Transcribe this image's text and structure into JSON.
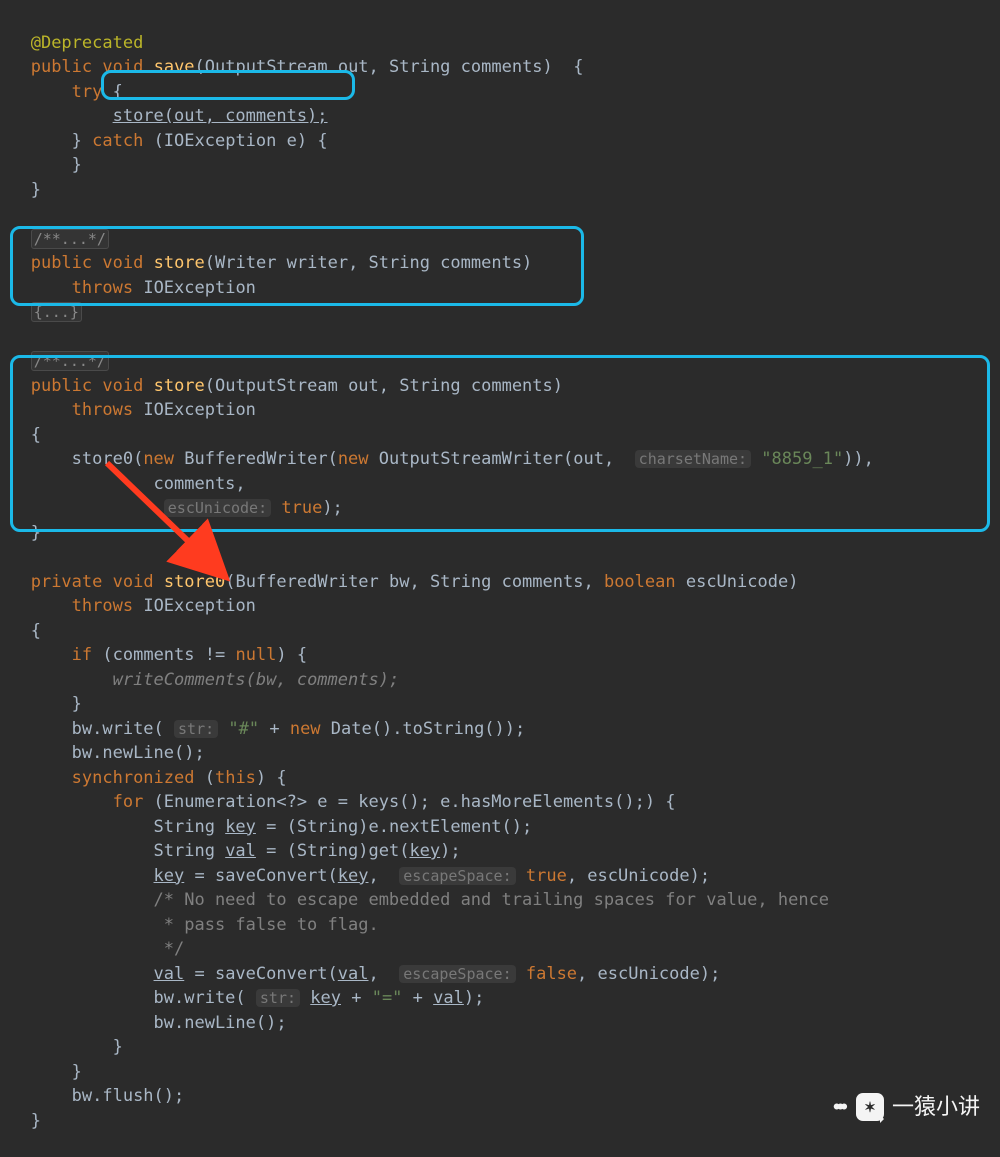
{
  "annotation_deprecated": "@Deprecated",
  "kw": {
    "public": "public",
    "void": "void",
    "try": "try",
    "catch": "catch",
    "throws": "throws",
    "new": "new",
    "private": "private",
    "boolean": "boolean",
    "if": "if",
    "null": "null",
    "synchronized": "synchronized",
    "this": "this",
    "for": "for",
    "true": "true",
    "false": "false"
  },
  "m": {
    "save": "save",
    "store": "store",
    "store0": "store0",
    "writeComments": "writeComments"
  },
  "sig": {
    "save_params": "(OutputStream out, String comments)",
    "store_writer_params": "(Writer writer, String comments)",
    "store_os_params": "(OutputStream out, String comments)",
    "store0_params": "(BufferedWriter bw, String comments, ",
    "store0_params_tail": " escUnicode)",
    "ioexception": "IOException",
    "catch_clause": "(IOException e)"
  },
  "call": {
    "store_out_comments": "store(out, comments);",
    "store0_prefix": "store0(",
    "buffered_writer": "BufferedWriter(",
    "osw": "OutputStreamWriter(out, ",
    "osw_close": ")),",
    "comments_line": "comments,",
    "store0_close": ");"
  },
  "hints": {
    "charsetName": "charsetName:",
    "escUnicode": "escUnicode:",
    "str": "str:",
    "escapeSpace": "escapeSpace:"
  },
  "strings": {
    "cs8859": "\"8859_1\"",
    "hash": "\"#\"",
    "eq": "\"=\""
  },
  "body": {
    "if_comments": "(comments != ",
    "write_comments_call": "(bw, comments);",
    "bw_write": "bw.write( ",
    "plus_new_date": " + ",
    "date_to_string": " Date().toString());",
    "bw_newline": "bw.newLine();",
    "sync_open": " (",
    "sync_close": ") {",
    "for_open": " (Enumeration<?> e = keys(); e.hasMoreElements();) {",
    "string_key": "String ",
    "key": "key",
    "eq_cast_next": " = (String)e.nextElement();",
    "val": "val",
    "eq_cast_get": " = (String)get(",
    "close_get": ");",
    "eq_saveConvert": " = saveConvert(",
    "comma_sp": ", ",
    "true_esc": " ",
    "esc_tail": ", escUnicode);",
    "bw_write2": "bw.write( ",
    "plus": " + ",
    "plus_val": " + ",
    "bw_flush": "bw.flush();"
  },
  "comments": {
    "fold": "/**...*/",
    "fold_body": "{...}",
    "noescape1": "/* No need to escape embedded and trailing spaces for value, hence",
    "noescape2": " * pass false to flag.",
    "noescape3": " */"
  },
  "watermark": {
    "text": "一猿小讲"
  },
  "colors": {
    "highlightBorder": "#1bb9e8",
    "arrow": "#ff3b1f"
  }
}
